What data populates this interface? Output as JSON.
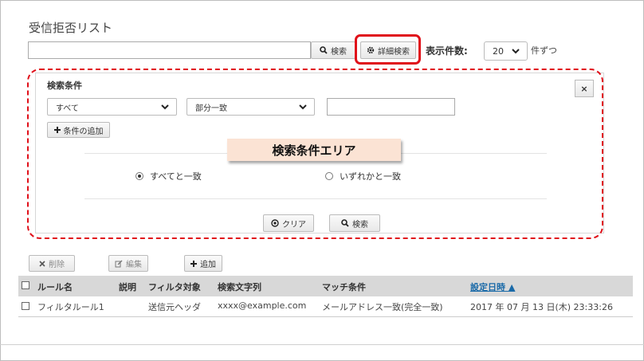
{
  "page": {
    "title": "受信拒否リスト"
  },
  "search": {
    "input_value": "",
    "search_label": "検索",
    "advanced_label": "詳細検索",
    "display_count_label": "表示件数:",
    "display_count_value": "20",
    "per_label": "件ずつ"
  },
  "panel": {
    "title": "検索条件",
    "close_label": "×",
    "target_select": "すべて",
    "match_select": "部分一致",
    "condition_value": "",
    "add_condition_label": "条件の追加",
    "area_label": "検索条件エリア",
    "radio_all": "すべてと一致",
    "radio_any": "いずれかと一致",
    "radio_selected": "all",
    "clear_label": "クリア",
    "search_label": "検索"
  },
  "toolbar": {
    "delete_label": "削除",
    "edit_label": "編集",
    "add_label": "追加"
  },
  "table": {
    "headers": {
      "rule_name": "ルール名",
      "description": "説明",
      "filter_target": "フィルタ対象",
      "search_string": "検索文字列",
      "match_condition": "マッチ条件",
      "set_datetime": "設定日時 ▲"
    },
    "rows": [
      {
        "rule_name": "フィルタルール1",
        "description": "",
        "filter_target": "送信元ヘッダ",
        "search_string": "xxxx@example.com",
        "match_condition": "メールアドレス一致(完全一致)",
        "set_datetime": "2017 年 07 月 13 日(木) 23:33:26"
      }
    ]
  },
  "colors": {
    "highlight_red": "#e0101a",
    "area_label_bg": "#fbe3d4",
    "table_header_bg": "#d8d8d8",
    "sort_link": "#1a6aa8"
  }
}
